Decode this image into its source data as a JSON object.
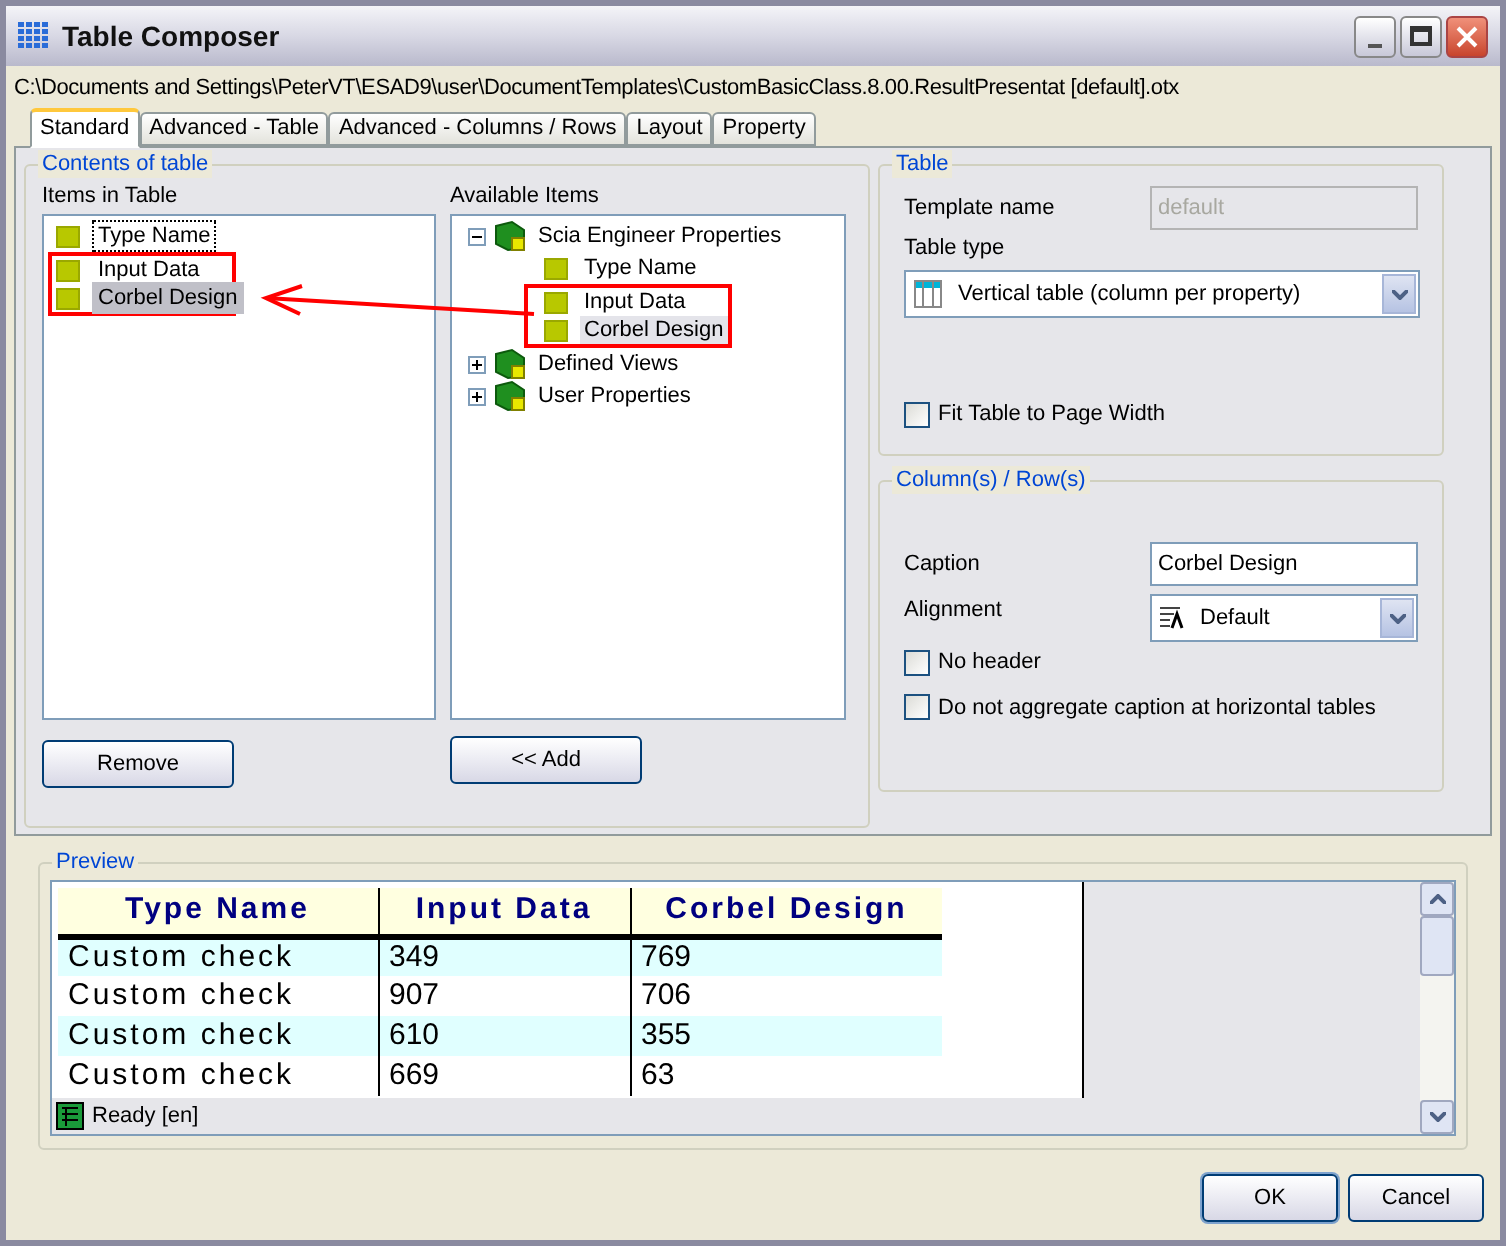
{
  "window": {
    "title": "Table Composer"
  },
  "path": "C:\\Documents and Settings\\PeterVT\\ESAD9\\user\\DocumentTemplates\\CustomBasicClass.8.00.ResultPresentat [default].otx",
  "tabs": [
    {
      "label": "Standard",
      "selected": true
    },
    {
      "label": "Advanced - Table",
      "selected": false
    },
    {
      "label": "Advanced - Columns / Rows",
      "selected": false
    },
    {
      "label": "Layout",
      "selected": false
    },
    {
      "label": "Property",
      "selected": false
    }
  ],
  "contents": {
    "title": "Contents of table",
    "items_label": "Items in Table",
    "available_label": "Available Items",
    "items": [
      {
        "label": "Type Name",
        "selected": false,
        "focused": true,
        "annotated": false
      },
      {
        "label": "Input Data",
        "selected": false,
        "focused": false,
        "annotated": true
      },
      {
        "label": "Corbel Design",
        "selected": true,
        "focused": false,
        "annotated": true
      }
    ],
    "available": [
      {
        "label": "Scia Engineer Properties",
        "expanded": true,
        "children": [
          {
            "label": "Type Name",
            "selected": false,
            "annotated": false
          },
          {
            "label": "Input Data",
            "selected": false,
            "annotated": true
          },
          {
            "label": "Corbel Design",
            "selected": true,
            "annotated": true
          }
        ]
      },
      {
        "label": "Defined Views",
        "expanded": false
      },
      {
        "label": "User Properties",
        "expanded": false
      }
    ],
    "remove_button": "Remove",
    "add_button": "<< Add"
  },
  "table": {
    "title": "Table",
    "template_label": "Template name",
    "template_value": "default",
    "template_disabled": true,
    "type_label": "Table type",
    "type_value": "Vertical table (column per property)",
    "fit": {
      "label": "Fit Table to Page Width",
      "checked": false
    }
  },
  "columns": {
    "title": "Column(s) / Row(s)",
    "caption_label": "Caption",
    "caption_value": "Corbel Design",
    "alignment_label": "Alignment",
    "alignment_value": "Default",
    "checkboxes": [
      {
        "label": "No header",
        "checked": false
      },
      {
        "label": "Do not aggregate caption at horizontal tables",
        "checked": false
      }
    ]
  },
  "preview": {
    "title": "Preview",
    "columns": [
      "Type Name",
      "Input Data",
      "Corbel Design"
    ],
    "rows": [
      [
        "Custom check",
        "349",
        "769"
      ],
      [
        "Custom check",
        "907",
        "706"
      ],
      [
        "Custom check",
        "610",
        "355"
      ],
      [
        "Custom check",
        "669",
        "63"
      ]
    ],
    "status": "Ready [en]"
  },
  "buttons": [
    "OK",
    "Cancel"
  ]
}
